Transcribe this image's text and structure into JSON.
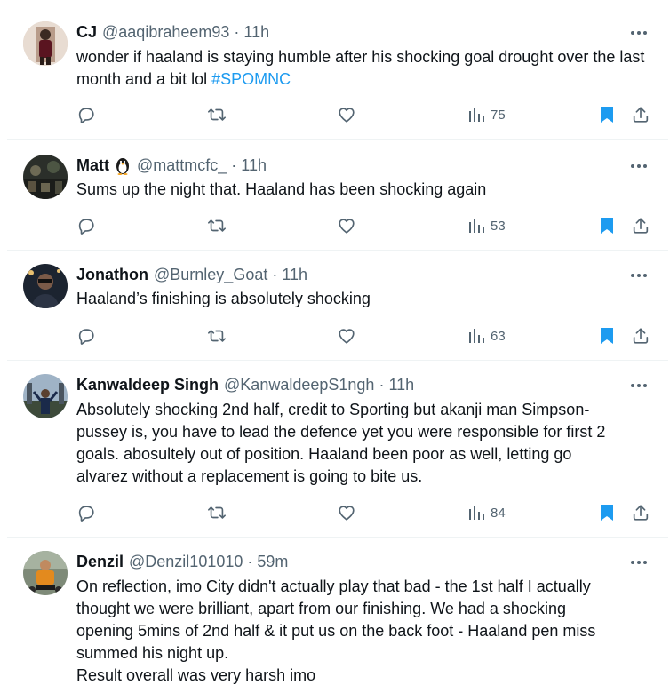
{
  "colors": {
    "text": "#0f1419",
    "secondary": "#536471",
    "link": "#1d9bf0",
    "divider": "#eff3f4",
    "bookmark_active": "#1d9bf0"
  },
  "tweets": [
    {
      "name": "CJ",
      "handle": "@aaqibraheem93",
      "separator": "·",
      "time": "11h",
      "text": "wonder if haaland is staying humble after his shocking goal drought over the last month and a bit lol ",
      "hashtag": "#SPOMNC",
      "views": "75",
      "avatar_icon": "avatar-photo-icon"
    },
    {
      "name": "Matt",
      "name_emoji": "penguin-icon",
      "handle": "@mattmcfc_",
      "separator": "·",
      "time": "11h",
      "text": "Sums up the night that. Haaland has been shocking again",
      "views": "53",
      "avatar_icon": "avatar-photo-icon"
    },
    {
      "name": "Jonathon",
      "handle": "@Burnley_Goat",
      "separator": "·",
      "time": "11h",
      "text": "Haaland’s finishing is absolutely shocking",
      "views": "63",
      "avatar_icon": "avatar-photo-icon"
    },
    {
      "name": "Kanwaldeep Singh",
      "handle": "@KanwaldeepS1ngh",
      "separator": "·",
      "time": "11h",
      "text": "Absolutely shocking 2nd half, credit to Sporting but akanji man Simpson-\npussey is, you have to lead the defence yet you were responsible for first 2\ngoals. abosultely out of position.  Haaland been poor as well, letting go\nalvarez without a replacement is going to bite us.",
      "views": "84",
      "avatar_icon": "avatar-photo-icon"
    },
    {
      "name": "Denzil",
      "handle": "@Denzil101010",
      "separator": "·",
      "time": "59m",
      "text": "On reflection, imo City didn't actually play that bad - the 1st half I actually\nthought we were brilliant, apart from our finishing. We had a shocking\nopening 5mins  of 2nd half & it put us on the back foot - Haaland pen miss\nsummed his night up.\nResult overall was very harsh imo",
      "avatar_icon": "avatar-photo-icon"
    }
  ]
}
